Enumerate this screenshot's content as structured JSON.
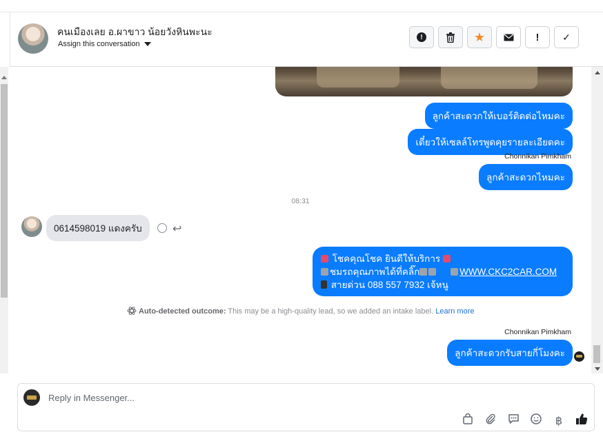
{
  "header": {
    "contact_name": "คนเมืองเลย อ.ผาขาว น้อยวังหินพะนะ",
    "assign_label": "Assign this conversation",
    "toolbar": [
      {
        "name": "spam-button",
        "icon": "alert-circle-icon",
        "glyph": "❗"
      },
      {
        "name": "delete-button",
        "icon": "trash-icon",
        "glyph": "🗑"
      },
      {
        "name": "star-button",
        "icon": "star-icon",
        "glyph": "★"
      },
      {
        "name": "mark-unread-button",
        "icon": "envelope-icon",
        "glyph": "✉"
      },
      {
        "name": "follow-up-button",
        "icon": "exclamation-icon",
        "glyph": "!"
      },
      {
        "name": "done-button",
        "icon": "check-icon",
        "glyph": "✓"
      }
    ]
  },
  "messages": {
    "out1": "ลูกค้าสะดวกให้เบอร์ติดต่อไหมคะ",
    "out2": "เดี๋ยวให้เซลล์โทรพูดคุยรายละเอียดคะ",
    "sender1": "Chonnikan Pimkham",
    "out3": "ลูกค้าสะดวกไหมคะ",
    "time": "08:31",
    "incoming": "0614598019 แดงครับ",
    "multi_line1": "โชคคุณโชค ยินดีให้บริการ",
    "multi_line2": "ชมรถคุณภาพได้ที่คลิ๊ก",
    "multi_link": "WWW.CKC2CAR.COM",
    "multi_line3": "สายด่วน 088 557 7932 เจ้หนู",
    "outcome_title": "Auto-detected outcome:",
    "outcome_text": "This may be a high-quality lead, so we added an intake label.",
    "outcome_link": "Learn more",
    "sender2": "Chonnikan Pimkham",
    "out4": "ลูกค้าสะดวกรับสายกี่โมงคะ"
  },
  "composer": {
    "placeholder": "Reply in Messenger...",
    "tools": [
      {
        "name": "shop-icon",
        "glyph": "⊓"
      },
      {
        "name": "attachment-icon",
        "glyph": "⌀"
      },
      {
        "name": "saved-replies-icon",
        "glyph": "💬"
      },
      {
        "name": "emoji-icon",
        "glyph": "☺"
      },
      {
        "name": "payment-icon",
        "glyph": "฿"
      },
      {
        "name": "like-icon",
        "glyph": "👍"
      }
    ]
  },
  "colors": {
    "outgoing_bubble": "#0a7cff",
    "incoming_bubble": "#e4e6eb",
    "star": "#f28b27",
    "link": "#216fdb"
  }
}
